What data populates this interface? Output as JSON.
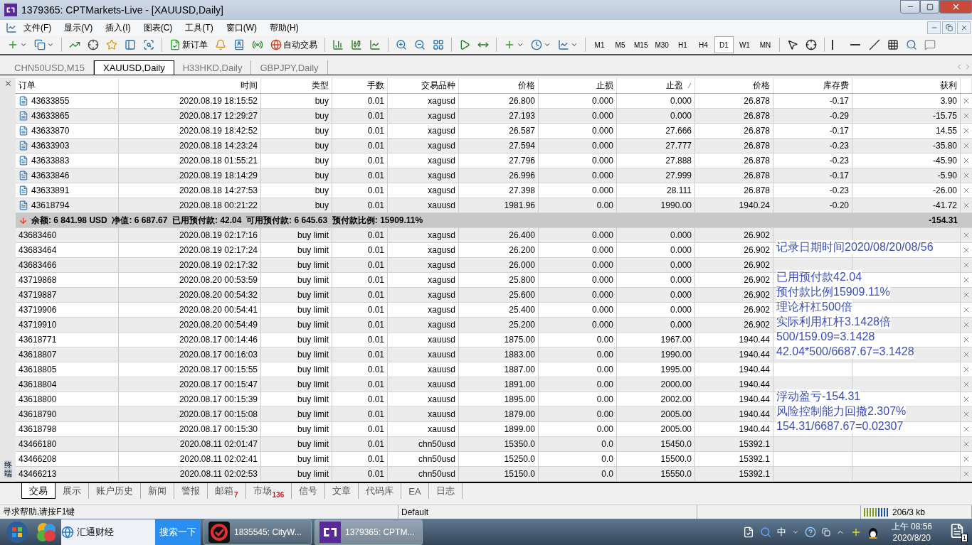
{
  "window": {
    "title": "1379365: CPTMarkets-Live - [XAUUSD,Daily]"
  },
  "menu": [
    "文件(F)",
    "显示(V)",
    "插入(I)",
    "图表(C)",
    "工具(T)",
    "窗口(W)",
    "帮助(H)"
  ],
  "toolbar": {
    "new_order": "新订单",
    "auto_trading": "自动交易",
    "timeframes": [
      {
        "label": "M1",
        "selected": false
      },
      {
        "label": "M5",
        "selected": false
      },
      {
        "label": "M15",
        "selected": false
      },
      {
        "label": "M30",
        "selected": false
      },
      {
        "label": "H1",
        "selected": false
      },
      {
        "label": "H4",
        "selected": false
      },
      {
        "label": "D1",
        "selected": true
      },
      {
        "label": "W1",
        "selected": false
      },
      {
        "label": "MN",
        "selected": false
      }
    ]
  },
  "chart_tabs": [
    {
      "label": "CHN50USD,M15",
      "selected": false
    },
    {
      "label": "XAUUSD,Daily",
      "selected": true
    },
    {
      "label": "H33HKD,Daily",
      "selected": false
    },
    {
      "label": "GBPJPY,Daily",
      "selected": false
    }
  ],
  "terminal": {
    "label": "终端",
    "columns": [
      {
        "label": "订单",
        "sorted": false
      },
      {
        "label": "时间",
        "sorted": false
      },
      {
        "label": "类型",
        "sorted": false
      },
      {
        "label": "手数",
        "sorted": false
      },
      {
        "label": "交易品种",
        "sorted": false
      },
      {
        "label": "价格",
        "sorted": false
      },
      {
        "label": "止损",
        "sorted": false
      },
      {
        "label": "止盈",
        "sorted": true
      },
      {
        "label": "价格",
        "sorted": false
      },
      {
        "label": "库存费",
        "sorted": false
      },
      {
        "label": "获利",
        "sorted": false
      }
    ],
    "positions": [
      {
        "order": "43633855",
        "time": "2020.08.19 18:15:52",
        "type": "buy",
        "lots": "0.01",
        "symbol": "xagusd",
        "price": "26.800",
        "sl": "0.000",
        "tp": "0.000",
        "current": "26.878",
        "swap": "-0.17",
        "profit": "3.90"
      },
      {
        "order": "43633865",
        "time": "2020.08.17 12:29:27",
        "type": "buy",
        "lots": "0.01",
        "symbol": "xagusd",
        "price": "27.193",
        "sl": "0.000",
        "tp": "0.000",
        "current": "26.878",
        "swap": "-0.29",
        "profit": "-15.75"
      },
      {
        "order": "43633870",
        "time": "2020.08.19 18:42:52",
        "type": "buy",
        "lots": "0.01",
        "symbol": "xagusd",
        "price": "26.587",
        "sl": "0.000",
        "tp": "27.666",
        "current": "26.878",
        "swap": "-0.17",
        "profit": "14.55"
      },
      {
        "order": "43633903",
        "time": "2020.08.18 14:23:24",
        "type": "buy",
        "lots": "0.01",
        "symbol": "xagusd",
        "price": "27.594",
        "sl": "0.000",
        "tp": "27.777",
        "current": "26.878",
        "swap": "-0.23",
        "profit": "-35.80"
      },
      {
        "order": "43633883",
        "time": "2020.08.18 01:55:21",
        "type": "buy",
        "lots": "0.01",
        "symbol": "xagusd",
        "price": "27.796",
        "sl": "0.000",
        "tp": "27.888",
        "current": "26.878",
        "swap": "-0.23",
        "profit": "-45.90"
      },
      {
        "order": "43633846",
        "time": "2020.08.19 18:14:29",
        "type": "buy",
        "lots": "0.01",
        "symbol": "xagusd",
        "price": "26.996",
        "sl": "0.000",
        "tp": "27.999",
        "current": "26.878",
        "swap": "-0.17",
        "profit": "-5.90"
      },
      {
        "order": "43633891",
        "time": "2020.08.18 14:27:53",
        "type": "buy",
        "lots": "0.01",
        "symbol": "xagusd",
        "price": "27.398",
        "sl": "0.000",
        "tp": "28.111",
        "current": "26.878",
        "swap": "-0.23",
        "profit": "-26.00"
      },
      {
        "order": "43618794",
        "time": "2020.08.18 00:21:22",
        "type": "buy",
        "lots": "0.01",
        "symbol": "xauusd",
        "price": "1981.96",
        "sl": "0.00",
        "tp": "1990.00",
        "current": "1940.24",
        "swap": "-0.20",
        "profit": "-41.72"
      }
    ],
    "summary": {
      "text": "余额: 6 841.98 USD  净值: 6 687.67  已用预付款: 42.04  可用预付款: 6 645.63  预付款比例: 15909.11%",
      "profit": "-154.31"
    },
    "pending": [
      {
        "order": "43683460",
        "time": "2020.08.19 02:17:16",
        "type": "buy limit",
        "lots": "0.01",
        "symbol": "xagusd",
        "price": "26.400",
        "sl": "0.000",
        "tp": "0.000",
        "current": "26.902"
      },
      {
        "order": "43683464",
        "time": "2020.08.19 02:17:24",
        "type": "buy limit",
        "lots": "0.01",
        "symbol": "xagusd",
        "price": "26.200",
        "sl": "0.000",
        "tp": "0.000",
        "current": "26.902",
        "note": "记录日期时间2020/08/20/08/56"
      },
      {
        "order": "43683466",
        "time": "2020.08.19 02:17:32",
        "type": "buy limit",
        "lots": "0.01",
        "symbol": "xagusd",
        "price": "26.000",
        "sl": "0.000",
        "tp": "0.000",
        "current": "26.902"
      },
      {
        "order": "43719868",
        "time": "2020.08.20 00:53:59",
        "type": "buy limit",
        "lots": "0.01",
        "symbol": "xagusd",
        "price": "25.800",
        "sl": "0.000",
        "tp": "0.000",
        "current": "26.902",
        "note": "已用预付款42.04"
      },
      {
        "order": "43719887",
        "time": "2020.08.20 00:54:32",
        "type": "buy limit",
        "lots": "0.01",
        "symbol": "xagusd",
        "price": "25.600",
        "sl": "0.000",
        "tp": "0.000",
        "current": "26.902",
        "note": "预付款比例15909.11%"
      },
      {
        "order": "43719906",
        "time": "2020.08.20 00:54:41",
        "type": "buy limit",
        "lots": "0.01",
        "symbol": "xagusd",
        "price": "25.400",
        "sl": "0.000",
        "tp": "0.000",
        "current": "26.902",
        "note": "理论杆杠500倍"
      },
      {
        "order": "43719910",
        "time": "2020.08.20 00:54:49",
        "type": "buy limit",
        "lots": "0.01",
        "symbol": "xagusd",
        "price": "25.200",
        "sl": "0.000",
        "tp": "0.000",
        "current": "26.902",
        "note": "实际利用杠杆3.1428倍"
      },
      {
        "order": "43618771",
        "time": "2020.08.17 00:14:46",
        "type": "buy limit",
        "lots": "0.01",
        "symbol": "xauusd",
        "price": "1875.00",
        "sl": "0.00",
        "tp": "1967.00",
        "current": "1940.44",
        "note": "500/159.09=3.1428"
      },
      {
        "order": "43618807",
        "time": "2020.08.17 00:16:03",
        "type": "buy limit",
        "lots": "0.01",
        "symbol": "xauusd",
        "price": "1883.00",
        "sl": "0.00",
        "tp": "1990.00",
        "current": "1940.44",
        "note": "42.04*500/6687.67=3.1428"
      },
      {
        "order": "43618805",
        "time": "2020.08.17 00:15:55",
        "type": "buy limit",
        "lots": "0.01",
        "symbol": "xauusd",
        "price": "1887.00",
        "sl": "0.00",
        "tp": "1995.00",
        "current": "1940.44"
      },
      {
        "order": "43618804",
        "time": "2020.08.17 00:15:47",
        "type": "buy limit",
        "lots": "0.01",
        "symbol": "xauusd",
        "price": "1891.00",
        "sl": "0.00",
        "tp": "2000.00",
        "current": "1940.44"
      },
      {
        "order": "43618800",
        "time": "2020.08.17 00:15:39",
        "type": "buy limit",
        "lots": "0.01",
        "symbol": "xauusd",
        "price": "1895.00",
        "sl": "0.00",
        "tp": "2002.00",
        "current": "1940.44",
        "note": "浮动盈亏-154.31"
      },
      {
        "order": "43618790",
        "time": "2020.08.17 00:15:08",
        "type": "buy limit",
        "lots": "0.01",
        "symbol": "xauusd",
        "price": "1879.00",
        "sl": "0.00",
        "tp": "2005.00",
        "current": "1940.44",
        "note": "风险控制能力回撤2.307%"
      },
      {
        "order": "43618798",
        "time": "2020.08.17 00:15:30",
        "type": "buy limit",
        "lots": "0.01",
        "symbol": "xauusd",
        "price": "1899.00",
        "sl": "0.00",
        "tp": "2005.00",
        "current": "1940.44",
        "note": "154.31/6687.67=0.02307"
      },
      {
        "order": "43466180",
        "time": "2020.08.11 02:01:47",
        "type": "buy limit",
        "lots": "0.01",
        "symbol": "chn50usd",
        "price": "15350.0",
        "sl": "0.0",
        "tp": "15450.0",
        "current": "15392.1"
      },
      {
        "order": "43466208",
        "time": "2020.08.11 02:02:41",
        "type": "buy limit",
        "lots": "0.01",
        "symbol": "chn50usd",
        "price": "15250.0",
        "sl": "0.0",
        "tp": "15500.0",
        "current": "15392.1"
      },
      {
        "order": "43466213",
        "time": "2020.08.11 02:02:53",
        "type": "buy limit",
        "lots": "0.01",
        "symbol": "chn50usd",
        "price": "15150.0",
        "sl": "0.0",
        "tp": "15550.0",
        "current": "15392.1"
      }
    ]
  },
  "bottom_tabs": [
    {
      "label": "交易",
      "selected": true
    },
    {
      "label": "展示",
      "selected": false
    },
    {
      "label": "账户历史",
      "selected": false
    },
    {
      "label": "新闻",
      "selected": false
    },
    {
      "label": "警报",
      "selected": false
    },
    {
      "label": "邮箱",
      "badge": "7",
      "selected": false
    },
    {
      "label": "市场",
      "badge": "136",
      "selected": false
    },
    {
      "label": "信号",
      "selected": false
    },
    {
      "label": "文章",
      "selected": false
    },
    {
      "label": "代码库",
      "selected": false
    },
    {
      "label": "EA",
      "selected": false
    },
    {
      "label": "日志",
      "selected": false
    }
  ],
  "status_bar": {
    "help": "寻求帮助,请按F1键",
    "profile": "Default",
    "traffic": "206/3 kb"
  },
  "taskbar": {
    "search_value": "汇通财经",
    "search_button": "搜索一下",
    "tasks": [
      {
        "label": "1835545: CityW...",
        "selected": false
      },
      {
        "label": "1379365: CPTM...",
        "selected": true
      }
    ],
    "ime": "中",
    "time": "上午 08:56",
    "date": "2020/8/20",
    "notification_count": "1"
  }
}
